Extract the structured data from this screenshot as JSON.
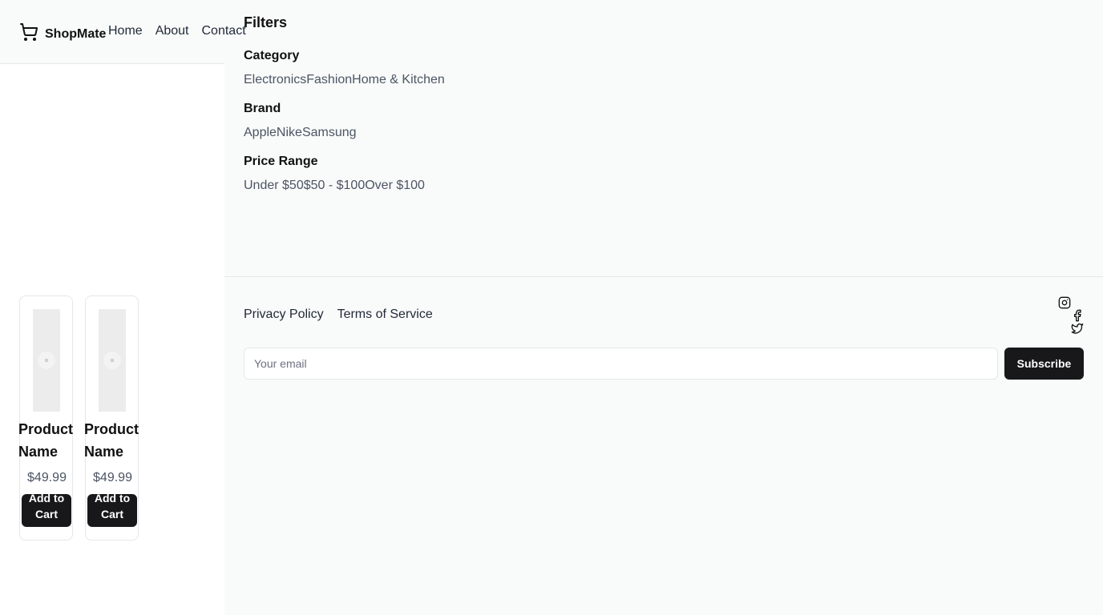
{
  "header": {
    "brand": "ShopMate",
    "nav": [
      "Home",
      "About",
      "Contact"
    ]
  },
  "filters": {
    "title": "Filters",
    "groups": [
      {
        "label": "Category",
        "options": [
          "Electronics",
          "Fashion",
          "Home & Kitchen"
        ]
      },
      {
        "label": "Brand",
        "options": [
          "Apple",
          "Nike",
          "Samsung"
        ]
      },
      {
        "label": "Price Range",
        "options": [
          "Under $50",
          "$50 - $100",
          "Over $100"
        ]
      }
    ]
  },
  "products": [
    {
      "name": "Product Name",
      "price": "$49.99",
      "button": "Add to Cart"
    },
    {
      "name": "Product Name",
      "price": "$49.99",
      "button": "Add to Cart"
    }
  ],
  "footer": {
    "links": [
      "Privacy Policy",
      "Terms of Service"
    ],
    "socials": [
      "instagram-icon",
      "facebook-icon",
      "twitter-icon"
    ],
    "email_placeholder": "Your email",
    "subscribe_label": "Subscribe"
  },
  "colors": {
    "panel_bg": "#f9fafa",
    "button_bg": "#18181b",
    "muted_text": "#4b5563"
  }
}
